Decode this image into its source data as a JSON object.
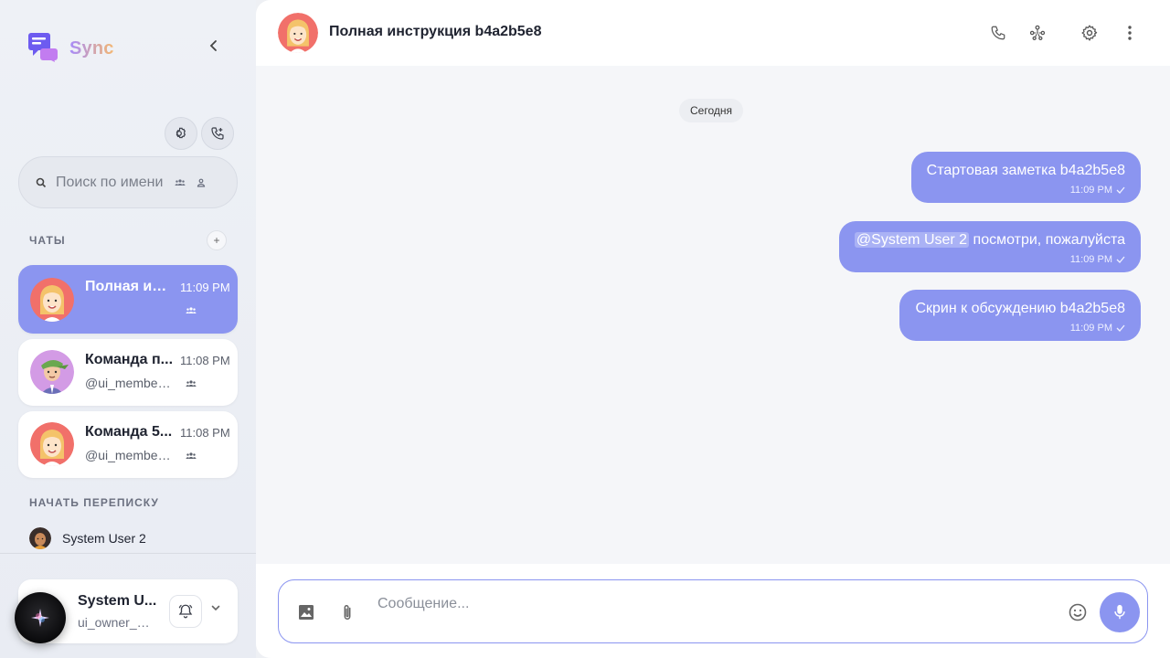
{
  "brand": {
    "name": "Sync"
  },
  "sidebar": {
    "search_placeholder": "Поиск по имени",
    "chats_label": "ЧАТЫ",
    "add_chat_symbol": "+",
    "chats": [
      {
        "name": "Полная инструкция b4a2b5e8",
        "time": "11:09 PM",
        "subtitle": ""
      },
      {
        "name": "Команда п...",
        "time": "11:08 PM",
        "subtitle": "@ui_member_..."
      },
      {
        "name": "Команда 5...",
        "time": "11:08 PM",
        "subtitle": "@ui_member_..."
      }
    ],
    "start_label": "НАЧАТЬ ПЕРЕПИСКУ",
    "contacts": [
      {
        "name": "System User 2"
      }
    ]
  },
  "user": {
    "name": "System U...",
    "handle": "ui_owner_g..."
  },
  "chat": {
    "title": "Полная инструкция b4a2b5e8",
    "date_separator": "Сегодня",
    "messages": [
      {
        "text": "Стартовая заметка b4a2b5e8",
        "time": "11:09 PM"
      },
      {
        "mention": "@System User 2",
        "text": " посмотри, пожалуйста",
        "time": "11:09 PM"
      },
      {
        "text": "Скрин к обсуждению b4a2b5e8",
        "time": "11:09 PM"
      }
    ]
  },
  "composer": {
    "placeholder": "Сообщение..."
  },
  "colors": {
    "accent": "#8b95f0",
    "sidebar_bg": "#eef1f6",
    "main_bg": "#f5f6f9"
  },
  "icons": [
    "chat-logo-icon",
    "chevron-left-icon",
    "settings-icon",
    "add-call-icon",
    "search-icon",
    "group-icon",
    "person-icon",
    "phone-icon",
    "hub-icon",
    "more-vert-icon",
    "image-icon",
    "paperclip-icon",
    "emoji-icon",
    "mic-icon",
    "bell-icon",
    "chevron-down-icon",
    "check-icon"
  ]
}
